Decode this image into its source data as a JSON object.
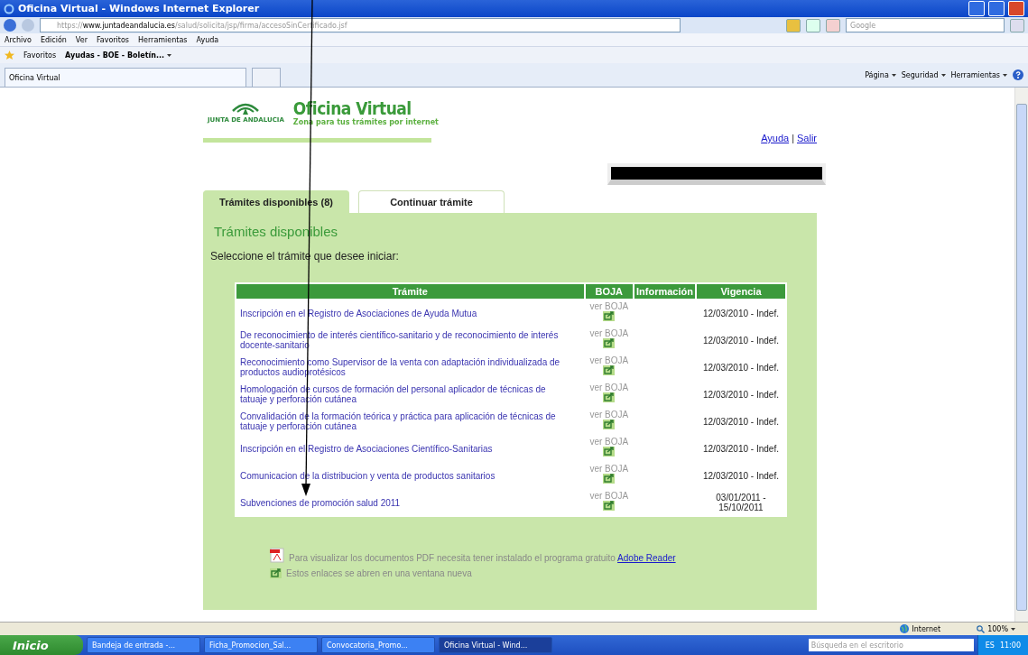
{
  "window": {
    "title": "Oficina Virtual - Windows Internet Explorer"
  },
  "address_bar": {
    "scheme": "https://",
    "host": "www.juntadeandalucia.es",
    "path": "/salud/solicita/jsp/firma/accesoSinCertificado.jsf"
  },
  "search": {
    "placeholder": "Google"
  },
  "menu": [
    "Archivo",
    "Edición",
    "Ver",
    "Favoritos",
    "Herramientas",
    "Ayuda"
  ],
  "favorites_bar": {
    "label": "Favoritos",
    "items": [
      "Ayudas - BOE - Boletín..."
    ]
  },
  "browser_tab": {
    "label": "Oficina Virtual"
  },
  "command_bar": [
    "Página",
    "Seguridad",
    "Herramientas"
  ],
  "page": {
    "logo": {
      "org": "JUNTA DE ANDALUCIA",
      "title": "Oficina Virtual",
      "subtitle": "Zona para tus trámites por internet"
    },
    "header_links": [
      "Ayuda",
      "Salir"
    ],
    "header_separator": "|",
    "tabs": [
      {
        "label": "Trámites disponibles (8)",
        "selected": true
      },
      {
        "label": "Continuar trámite",
        "selected": false
      }
    ],
    "heading": "Trámites disponibles",
    "instruction": "Seleccione el trámite que desee iniciar:",
    "table": {
      "columns": [
        "Trámite",
        "BOJA",
        "Información",
        "Vigencia"
      ],
      "rows": [
        {
          "tramite": "Inscripción en el Registro de Asociaciones de Ayuda Mutua",
          "boja": "ver BOJA",
          "vigencia": "12/03/2010 - Indef."
        },
        {
          "tramite": "De reconocimiento de interés científico-sanitario y de reconocimiento de interés docente-sanitario",
          "boja": "ver BOJA",
          "vigencia": "12/03/2010 - Indef."
        },
        {
          "tramite": "Reconocimiento como Supervisor de la venta con adaptación individualizada de productos audioprotésicos",
          "boja": "ver BOJA",
          "vigencia": "12/03/2010 - Indef."
        },
        {
          "tramite": "Homologación de cursos de formación del personal aplicador de técnicas de tatuaje y perforación cutánea",
          "boja": "ver BOJA",
          "vigencia": "12/03/2010 - Indef."
        },
        {
          "tramite": "Convalidación de la formación teórica y práctica para aplicación de técnicas de tatuaje y perforación cutánea",
          "boja": "ver BOJA",
          "vigencia": "12/03/2010 - Indef."
        },
        {
          "tramite": "Inscripción en el Registro de Asociaciones Científico-Sanitarias",
          "boja": "ver BOJA",
          "vigencia": "12/03/2010 - Indef."
        },
        {
          "tramite": "Comunicacion de la distribucion y venta de productos sanitarios",
          "boja": "ver BOJA",
          "vigencia": "12/03/2010 - Indef."
        },
        {
          "tramite": "Subvenciones de promoción salud 2011",
          "boja": "ver BOJA",
          "vigencia": "03/01/2011 - 15/10/2011"
        }
      ]
    },
    "pdf_note": {
      "text": "Para visualizar los documentos PDF necesita tener instalado el programa gratuito",
      "link": "Adobe Reader"
    },
    "window_note": "Estos enlaces se abren en una ventana nueva"
  },
  "status_bar": {
    "zone": "Internet",
    "zoom": "100%"
  },
  "taskbar": {
    "start": "Inicio",
    "tasks": [
      {
        "label": "Bandeja de entrada -...",
        "selected": false
      },
      {
        "label": "Ficha_Promocion_Sal...",
        "selected": false
      },
      {
        "label": "Convocatoria_Promo...",
        "selected": false
      },
      {
        "label": "Oficina Virtual - Wind...",
        "selected": true
      }
    ],
    "search_placeholder": "Búsqueda en el escritorio",
    "language": "ES",
    "clock": "11:00"
  }
}
